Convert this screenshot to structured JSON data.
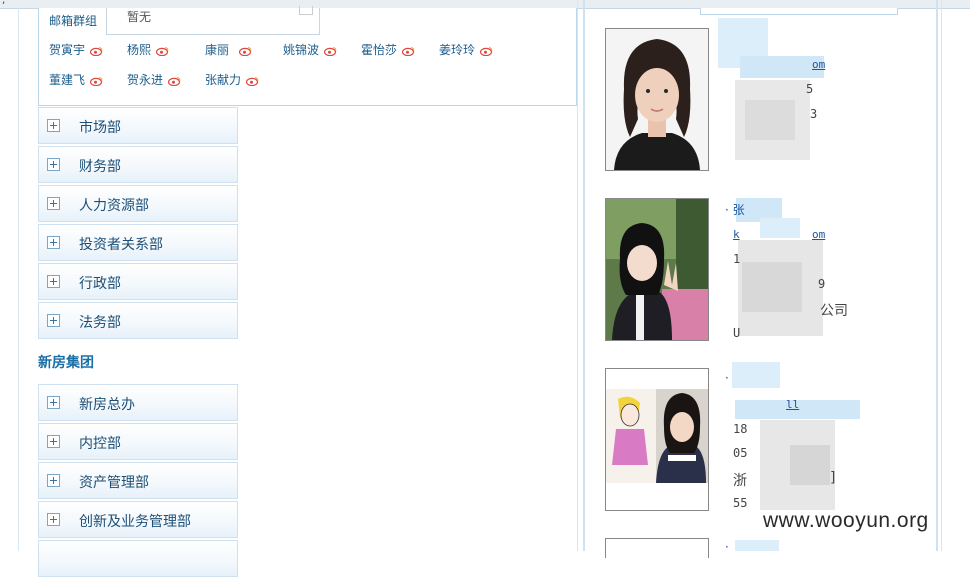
{
  "mail_group": {
    "label": "邮箱群组",
    "popup_text": "暂无",
    "row1": [
      "贺寅宇",
      "杨熙",
      "康丽",
      "姚锦波",
      "霍怡莎",
      "姜玲玲"
    ],
    "row2": [
      "董建飞",
      "贺永进",
      "张献力"
    ],
    "icon": "weibo-icon"
  },
  "departments_a": [
    "市场部",
    "财务部",
    "人力资源部",
    "投资者关系部",
    "行政部",
    "法务部"
  ],
  "group_title": "新房集团",
  "departments_b": [
    "新房总办",
    "内控部",
    "资产管理部",
    "创新及业务管理部"
  ],
  "contacts": [
    {
      "email_tail": "om",
      "line2": "5",
      "line3": "3"
    },
    {
      "name_prefix": "·",
      "name_tail": "张",
      "email_head": "k",
      "email_tail": "om",
      "line2": "1",
      "line3": "9",
      "company_tail": "公司",
      "line5": "U"
    },
    {
      "name_prefix": "·",
      "email_tail": "ll",
      "line2": "18",
      "line3": "05",
      "company_head": "浙",
      "company_tail": "]",
      "line5": "55"
    },
    {
      "name_prefix": "·"
    }
  ],
  "watermark": "www.wooyun.org",
  "colors": {
    "link": "#1a55a3",
    "border": "#cfe1ef",
    "group_title": "#1a6fa6"
  }
}
